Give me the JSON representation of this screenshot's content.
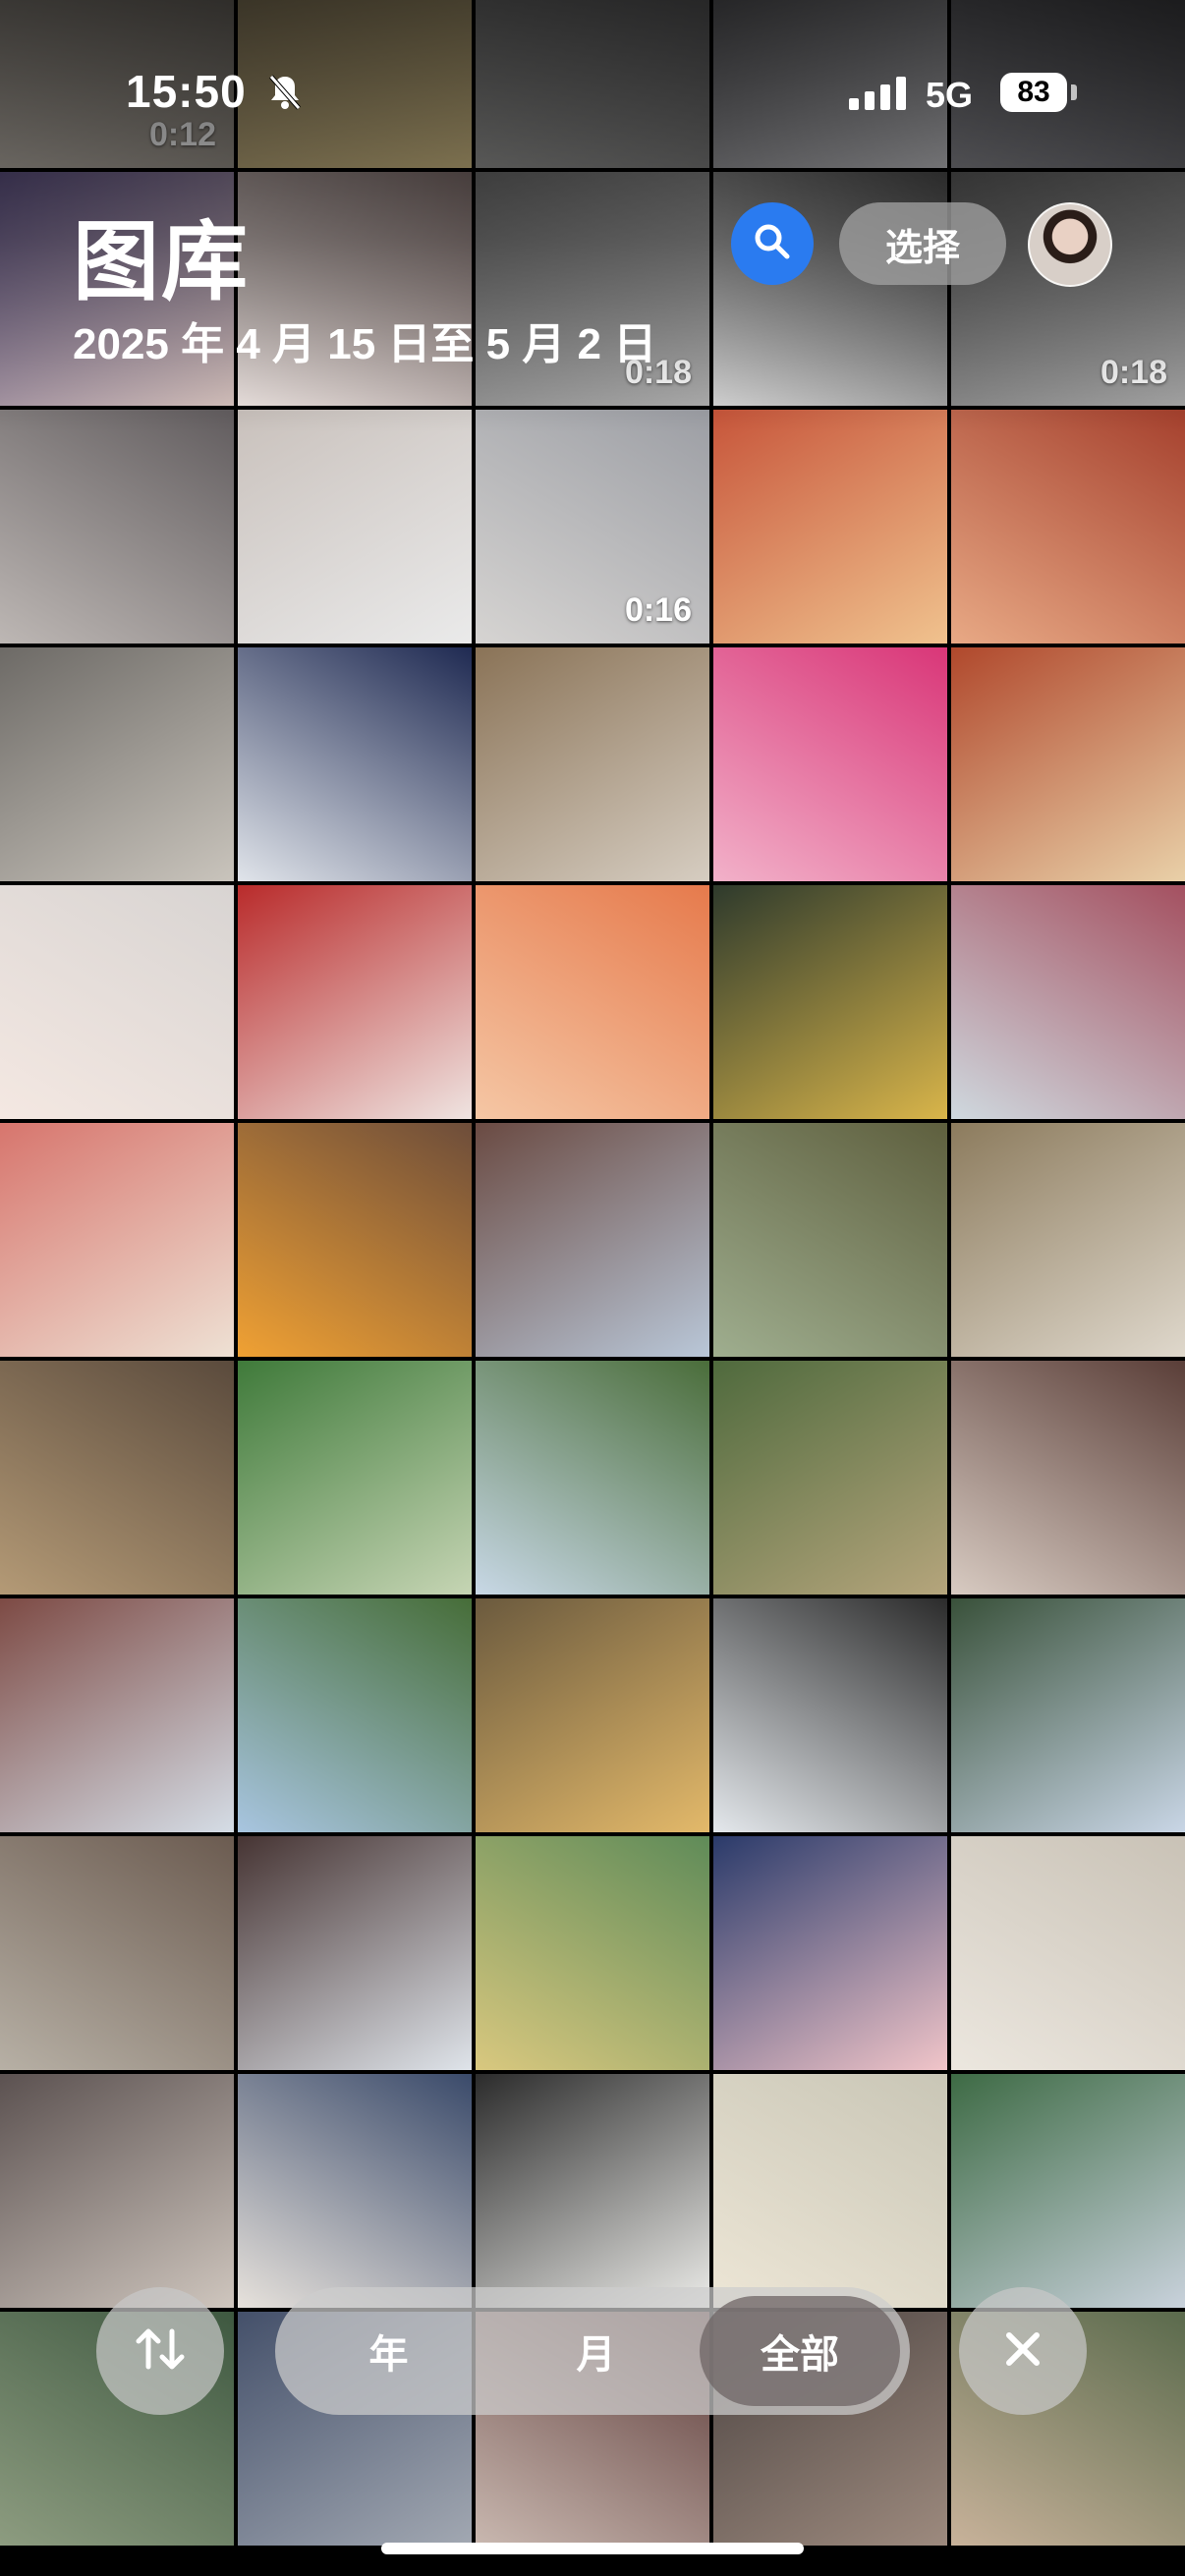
{
  "status": {
    "time": "15:50",
    "network": "5G",
    "battery": "83",
    "icons": [
      "bell-slash-icon",
      "signal-icon",
      "battery-icon"
    ]
  },
  "header": {
    "title": "图库",
    "date_range": "2025 年 4 月 15 日至 5 月 2 日",
    "select_label": "选择",
    "search_icon": "search-icon",
    "avatar": "profile-avatar",
    "accent": "#2a7bf0"
  },
  "grid": {
    "tiles": [
      {
        "c1": "#6f6a62",
        "c2": "#b8b1a8",
        "dur": "0:12"
      },
      {
        "c1": "#8b7d60",
        "c2": "#d9c48a",
        "dur": ""
      },
      {
        "c1": "#5a5a5c",
        "c2": "#9a9a98",
        "dur": ""
      },
      {
        "c1": "#4e4e52",
        "c2": "#c8c8cc",
        "dur": ""
      },
      {
        "c1": "#3a3a3e",
        "c2": "#8a8a90",
        "dur": ""
      },
      {
        "c1": "#5b4f7e",
        "c2": "#d9c5c0",
        "dur": ""
      },
      {
        "c1": "#7a6a68",
        "c2": "#efe6e3",
        "dur": ""
      },
      {
        "c1": "#6a6a6a",
        "c2": "#b0b0b0",
        "dur": "0:18"
      },
      {
        "c1": "#4a4a4a",
        "c2": "#d8d8d8",
        "dur": ""
      },
      {
        "c1": "#5a5a5a",
        "c2": "#a8a8a8",
        "dur": "0:18"
      },
      {
        "c1": "#615c5e",
        "c2": "#bdb7b4",
        "dur": ""
      },
      {
        "c1": "#c9c1bc",
        "c2": "#eaeaea",
        "dur": ""
      },
      {
        "c1": "#9c9ea4",
        "c2": "#d6d4d2",
        "dur": "0:16"
      },
      {
        "c1": "#c7553a",
        "c2": "#f0c28e",
        "dur": ""
      },
      {
        "c1": "#a5402d",
        "c2": "#e8a985",
        "dur": ""
      },
      {
        "c1": "#6d6a66",
        "c2": "#c9c4bc",
        "dur": ""
      },
      {
        "c1": "#1f2a52",
        "c2": "#e0e4ea",
        "dur": ""
      },
      {
        "c1": "#8a7357",
        "c2": "#d6cdc1",
        "dur": ""
      },
      {
        "c1": "#d93678",
        "c2": "#f2b1c9",
        "dur": ""
      },
      {
        "c1": "#b0482c",
        "c2": "#e9d0a8",
        "dur": ""
      },
      {
        "c1": "#d8d4d2",
        "c2": "#f4e8e2",
        "dur": ""
      },
      {
        "c1": "#b92b2b",
        "c2": "#efe4e1",
        "dur": ""
      },
      {
        "c1": "#e67a4c",
        "c2": "#f5c7a5",
        "dur": ""
      },
      {
        "c1": "#2e3a2c",
        "c2": "#d9b54a",
        "dur": ""
      },
      {
        "c1": "#a45060",
        "c2": "#cfd9df",
        "dur": ""
      },
      {
        "c1": "#d7756d",
        "c2": "#eee1d4",
        "dur": ""
      },
      {
        "c1": "#6d4d3a",
        "c2": "#f0a133",
        "dur": ""
      },
      {
        "c1": "#6a4a42",
        "c2": "#b9c7d8",
        "dur": ""
      },
      {
        "c1": "#5e5f3e",
        "c2": "#9fae8f",
        "dur": ""
      },
      {
        "c1": "#8c7b5d",
        "c2": "#dfd8cc",
        "dur": ""
      },
      {
        "c1": "#5a4a3c",
        "c2": "#b49a76",
        "dur": ""
      },
      {
        "c1": "#3f7a3a",
        "c2": "#c6d5b4",
        "dur": ""
      },
      {
        "c1": "#4a6d3a",
        "c2": "#c8d8e6",
        "dur": ""
      },
      {
        "c1": "#4f6a3d",
        "c2": "#b5a57c",
        "dur": ""
      },
      {
        "c1": "#5a3e38",
        "c2": "#d8cbc2",
        "dur": ""
      },
      {
        "c1": "#7d4a44",
        "c2": "#d5dde6",
        "dur": ""
      },
      {
        "c1": "#466d38",
        "c2": "#a8c5e0",
        "dur": ""
      },
      {
        "c1": "#6b5a3e",
        "c2": "#e3b96a",
        "dur": ""
      },
      {
        "c1": "#2b2b2b",
        "c2": "#e4e8ec",
        "dur": ""
      },
      {
        "c1": "#39513a",
        "c2": "#c9d6e6",
        "dur": ""
      },
      {
        "c1": "#6b5b50",
        "c2": "#b7b0a5",
        "dur": ""
      },
      {
        "c1": "#463433",
        "c2": "#dfe4ea",
        "dur": ""
      },
      {
        "c1": "#5f8b58",
        "c2": "#d9c87f",
        "dur": ""
      },
      {
        "c1": "#2a3a6a",
        "c2": "#f1c5c9",
        "dur": ""
      },
      {
        "c1": "#c9c2b6",
        "c2": "#ece7df",
        "dur": ""
      },
      {
        "c1": "#5b5150",
        "c2": "#cfc6be",
        "dur": ""
      },
      {
        "c1": "#3a4a6a",
        "c2": "#e7e2dc",
        "dur": ""
      },
      {
        "c1": "#2b2b2b",
        "c2": "#ecece9",
        "dur": ""
      },
      {
        "c1": "#c9c6b6",
        "c2": "#ede6d6",
        "dur": ""
      },
      {
        "c1": "#3d6a44",
        "c2": "#c9d2dc",
        "dur": ""
      },
      {
        "c1": "#3e5840",
        "c2": "#8d9c80",
        "dur": ""
      },
      {
        "c1": "#44506a",
        "c2": "#a2a8b2",
        "dur": ""
      },
      {
        "c1": "#5c3a38",
        "c2": "#c9b8b0",
        "dur": ""
      },
      {
        "c1": "#4a4240",
        "c2": "#9d8a7e",
        "dur": ""
      },
      {
        "c1": "#5a6a4c",
        "c2": "#c8b29a",
        "dur": ""
      }
    ]
  },
  "bottom": {
    "sort_icon": "sort-arrows-icon",
    "close_icon": "close-icon",
    "segments": [
      {
        "label": "年",
        "active": false
      },
      {
        "label": "月",
        "active": false
      },
      {
        "label": "全部",
        "active": true
      }
    ]
  }
}
